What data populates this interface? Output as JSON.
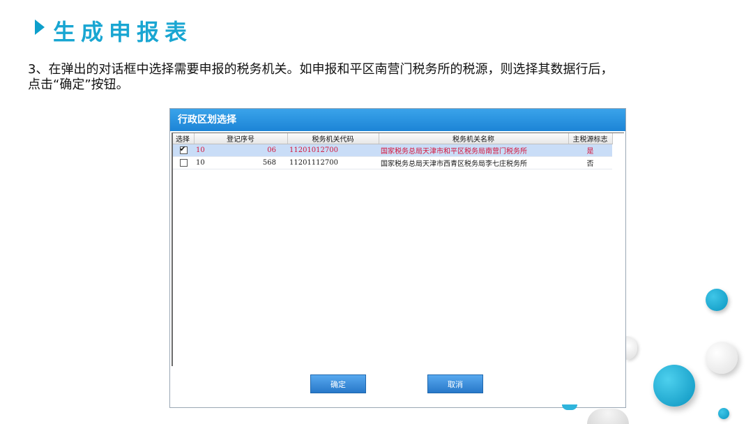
{
  "slide": {
    "title": "生成申报表",
    "instruction_line1": "3、在弹出的对话框中选择需要申报的税务机关。如申报和平区南营门税务所的税源，则选择其数据行后，",
    "instruction_line2": "点击“确定”按钮。"
  },
  "dialog": {
    "title": "行政区划选择",
    "columns": [
      "选择",
      "登记序号",
      "税务机关代码",
      "税务机关名称",
      "主税源标志"
    ],
    "rows": [
      {
        "selected": true,
        "reg_no_start": "10",
        "reg_no_end": "06",
        "code": "11201012700",
        "name": "国家税务总局天津市和平区税务局南营门税务所",
        "flag": "是"
      },
      {
        "selected": false,
        "reg_no_start": "10",
        "reg_no_end": "568",
        "code": "11201112700",
        "name": "国家税务总局天津市西青区税务局李七庄税务所",
        "flag": "否"
      }
    ],
    "confirm_label": "确定",
    "cancel_label": "取消"
  },
  "colors": {
    "accent": "#19a6d2",
    "dialog_title_bar": "#2a92df",
    "selected_row_bg": "#c9ddf7",
    "selected_row_text": "#d4143b"
  }
}
